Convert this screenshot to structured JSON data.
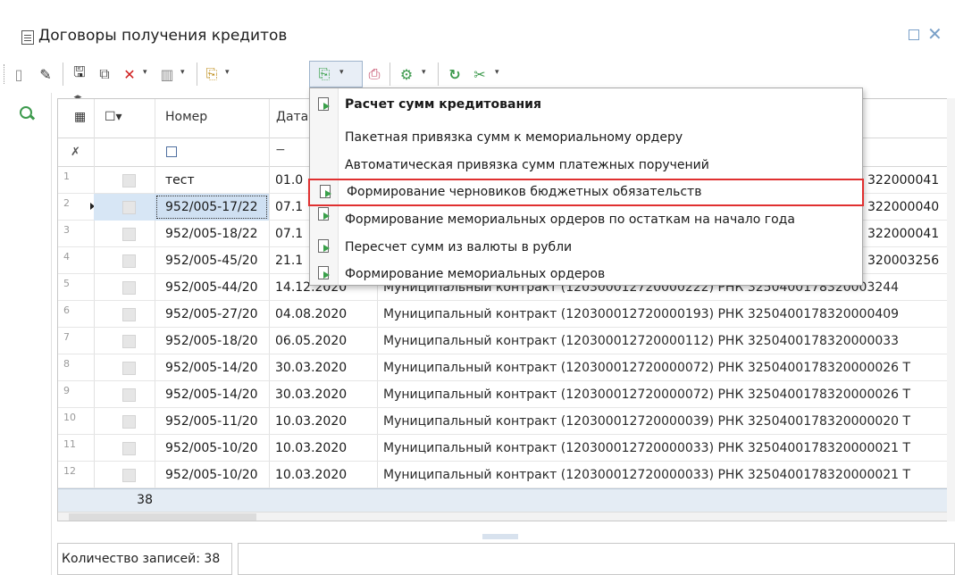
{
  "window": {
    "title": "Договоры получения кредитов"
  },
  "grid": {
    "columns": [
      "Номер",
      "Дата"
    ],
    "rows": [
      {
        "idx": "1",
        "nom": "тест",
        "date": "01.0",
        "desc": "",
        "tail": "322000041"
      },
      {
        "idx": "2",
        "nom": "952/005-17/22",
        "date": "07.1",
        "desc": "",
        "tail": "322000040"
      },
      {
        "idx": "3",
        "nom": "952/005-18/22",
        "date": "07.1",
        "desc": "",
        "tail": "322000041"
      },
      {
        "idx": "4",
        "nom": "952/005-45/20",
        "date": "21.1",
        "desc": "",
        "tail": "320003256"
      },
      {
        "idx": "5",
        "nom": "952/005-44/20",
        "date": "14.12.2020",
        "desc": "Муниципальный контракт (120300012720000222) РНК 3250400178320003244",
        "tail": ""
      },
      {
        "idx": "6",
        "nom": "952/005-27/20",
        "date": "04.08.2020",
        "desc": "Муниципальный контракт (120300012720000193) РНК 3250400178320000409",
        "tail": ""
      },
      {
        "idx": "7",
        "nom": "952/005-18/20",
        "date": "06.05.2020",
        "desc": "Муниципальный контракт (120300012720000112) РНК 3250400178320000033",
        "tail": ""
      },
      {
        "idx": "8",
        "nom": "952/005-14/20",
        "date": "30.03.2020",
        "desc": "Муниципальный контракт (120300012720000072) РНК 3250400178320000026 Т",
        "tail": ""
      },
      {
        "idx": "9",
        "nom": "952/005-14/20",
        "date": "30.03.2020",
        "desc": "Муниципальный контракт (120300012720000072) РНК 3250400178320000026 Т",
        "tail": ""
      },
      {
        "idx": "10",
        "nom": "952/005-11/20",
        "date": "10.03.2020",
        "desc": "Муниципальный контракт (120300012720000039) РНК 3250400178320000020 Т",
        "tail": ""
      },
      {
        "idx": "11",
        "nom": "952/005-10/20",
        "date": "10.03.2020",
        "desc": "Муниципальный контракт (120300012720000033) РНК 3250400178320000021 Т",
        "tail": ""
      },
      {
        "idx": "12",
        "nom": "952/005-10/20",
        "date": "10.03.2020",
        "desc": "Муниципальный контракт (120300012720000033) РНК 3250400178320000021 Т",
        "tail": ""
      }
    ],
    "total": "38",
    "selected_row": "2"
  },
  "status": {
    "records": "Количество записей: 38"
  },
  "menu": {
    "items": [
      {
        "label": "Расчет сумм кредитования"
      },
      {
        "label": "Пакетная привязка сумм к мемориальному ордеру"
      },
      {
        "label": "Автоматическая привязка сумм платежных поручений"
      },
      {
        "label": "Формирование черновиков бюджетных обязательств"
      },
      {
        "label": "Формирование мемориальных ордеров по остаткам на начало года"
      },
      {
        "label": "Пересчет сумм из валюты в рубли"
      },
      {
        "label": "Формирование мемориальных ордеров"
      }
    ]
  },
  "colors": {
    "highlight_border": "#e03030",
    "selection": "#cfe0f2",
    "accent_green": "#3d9a4d"
  }
}
